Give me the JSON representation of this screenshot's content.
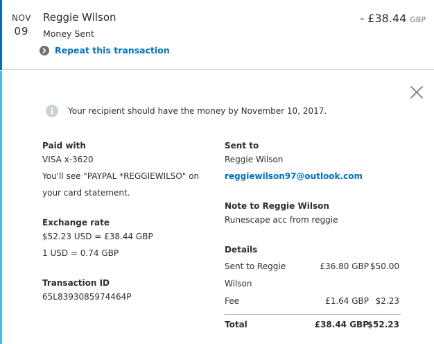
{
  "summary": {
    "month": "NOV",
    "day": "09",
    "name": "Reggie Wilson",
    "type": "Money Sent",
    "repeat_label": "Repeat this transaction",
    "amount": "- £38.44",
    "currency": "GBP"
  },
  "notice": "Your recipient should have the money by November 10, 2017.",
  "paid_with": {
    "label": "Paid with",
    "card": "VISA x-3620",
    "statement_line1": "You'll see \"PAYPAL *REGGIEWILSO\" on",
    "statement_line2": "your card statement."
  },
  "exchange_rate": {
    "label": "Exchange rate",
    "line1": "$52.23 USD = £38.44 GBP",
    "line2": "1 USD = 0.74 GBP"
  },
  "transaction_id": {
    "label": "Transaction ID",
    "value": "65L8393085974464P"
  },
  "sent_to": {
    "label": "Sent to",
    "name": "Reggie Wilson",
    "email": "reggiewilson97@outlook.com"
  },
  "note": {
    "label": "Note to Reggie Wilson",
    "text": "Runescape acc from reggie"
  },
  "details": {
    "label": "Details",
    "rows": [
      {
        "desc_line1": "Sent to Reggie",
        "desc_line2": "Wilson",
        "gbp": "£36.80 GBP",
        "usd": "$50.00"
      },
      {
        "desc_line1": "Fee",
        "gbp": "£1.64 GBP",
        "usd": "$2.23"
      }
    ],
    "total": {
      "desc": "Total",
      "gbp": "£38.44 GBP",
      "usd": "$52.23"
    }
  },
  "colors": {
    "link": "#0070ba",
    "summary_accent": "#0070ba",
    "detail_accent": "#3dc1f3",
    "text": "#2c2e2f",
    "muted": "#6c7378"
  },
  "icons": {
    "repeat": "chevron-right-circle-icon",
    "info": "info-icon",
    "close": "close-icon"
  }
}
